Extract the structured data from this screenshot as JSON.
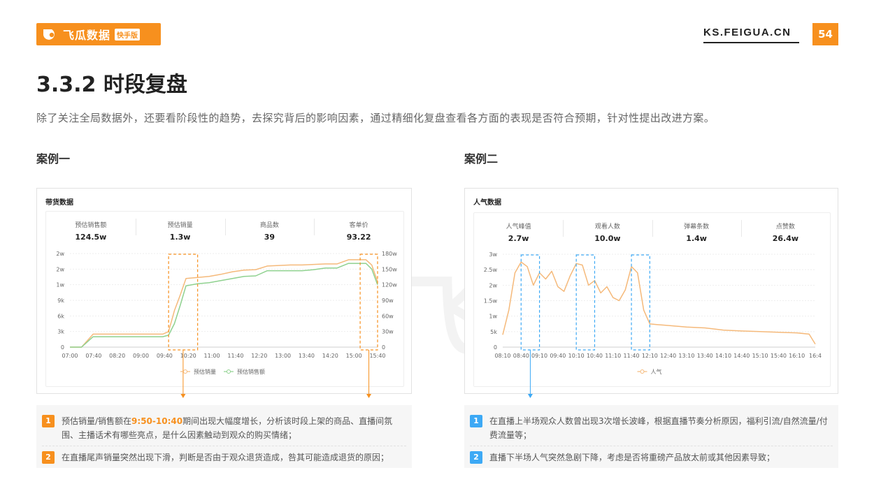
{
  "brand": {
    "name": "飞瓜数据",
    "badge": "快手版",
    "site": "KS.FEIGUA.CN",
    "page": "54",
    "accent": "#f7901e",
    "watermark": "飞瓜数据"
  },
  "title": "3.3.2 时段复盘",
  "subtitle": "除了关注全局数据外，还要看阶段性的趋势，去探究背后的影响因素，通过精细化复盘查看各方面的表现是否符合预期，针对性提出改进方案。",
  "case1": {
    "label": "案例一",
    "panel_title": "带货数据",
    "stats": [
      {
        "label": "预估销售额",
        "value": "124.5w"
      },
      {
        "label": "预估销量",
        "value": "1.3w"
      },
      {
        "label": "商品数",
        "value": "39"
      },
      {
        "label": "客单价",
        "value": "93.22"
      }
    ],
    "notes": [
      {
        "num": "1",
        "pre": "预估销量/销售额在",
        "highlight": "9:50-10:40",
        "post": "期间出现大幅度增长，分析该时段上架的商品、直播间氛围、主播话术有哪些亮点，是什么因素触动到观众的购买情绪；"
      },
      {
        "num": "2",
        "text": "在直播尾声销量突然出现下滑，判断是否由于观众退货造成，咎其可能造成退货的原因；"
      }
    ]
  },
  "case2": {
    "label": "案例二",
    "panel_title": "人气数据",
    "stats": [
      {
        "label": "人气峰值",
        "value": "2.7w"
      },
      {
        "label": "观看人数",
        "value": "10.0w"
      },
      {
        "label": "弹幕条数",
        "value": "1.4w"
      },
      {
        "label": "点赞数",
        "value": "26.4w"
      }
    ],
    "notes": [
      {
        "num": "1",
        "text": "在直播上半场观众人数曾出现3次增长波峰，根据直播节奏分析原因，福利引流/自然流量/付费流量等；"
      },
      {
        "num": "2",
        "text": "直播下半场人气突然急剧下降，考虑是否将重磅产品放太前或其他因素导致；"
      }
    ]
  },
  "chart_data": [
    {
      "type": "line",
      "x": [
        "07:00",
        "07:20",
        "07:40",
        "08:00",
        "08:20",
        "08:40",
        "09:00",
        "09:20",
        "09:40",
        "09:50",
        "10:00",
        "10:10",
        "10:20",
        "10:30",
        "10:40",
        "11:00",
        "11:20",
        "11:40",
        "12:00",
        "12:20",
        "12:40",
        "13:00",
        "13:20",
        "13:40",
        "14:00",
        "14:20",
        "14:40",
        "15:00",
        "15:20",
        "15:30",
        "15:40",
        "15:50"
      ],
      "x_tick_labels": [
        "07:00",
        "07:40",
        "08:20",
        "09:00",
        "09:40",
        "10:20",
        "11:00",
        "11:40",
        "12:20",
        "13:00",
        "13:40",
        "14:20",
        "15:00",
        "15:40"
      ],
      "y_left_tick_labels": [
        "0",
        "3k",
        "6k",
        "9k",
        "1w",
        "2w",
        "2w"
      ],
      "y_right_tick_labels": [
        "0",
        "30w",
        "60w",
        "90w",
        "120w",
        "150w",
        "180w"
      ],
      "ylim_left": [
        0,
        18000
      ],
      "ylim_right": [
        0,
        1800000
      ],
      "series": [
        {
          "name": "预估销量",
          "color": "#f5b97a",
          "axis": "left",
          "values": [
            0,
            0,
            2500,
            2500,
            2500,
            2500,
            2500,
            2500,
            2500,
            3000,
            7000,
            10000,
            13200,
            13300,
            13400,
            13600,
            14000,
            14500,
            14800,
            14900,
            15600,
            15700,
            15800,
            15800,
            15900,
            16000,
            16000,
            16800,
            16800,
            16800,
            15800,
            12600
          ]
        },
        {
          "name": "预估销售额",
          "color": "#8fd18f",
          "axis": "left",
          "values": [
            0,
            0,
            2000,
            2000,
            2000,
            2000,
            2000,
            2000,
            2000,
            2300,
            4500,
            8000,
            11800,
            12000,
            12200,
            12400,
            12800,
            13200,
            13600,
            13700,
            14700,
            14700,
            14700,
            14700,
            14900,
            15200,
            15200,
            16100,
            16100,
            16100,
            15000,
            12000
          ]
        }
      ],
      "highlights": [
        [
          "09:50",
          "10:40"
        ],
        [
          "15:20",
          "15:50"
        ]
      ],
      "grid": true,
      "legend": "bottom"
    },
    {
      "type": "line",
      "x": [
        "08:10",
        "08:20",
        "08:30",
        "08:40",
        "08:50",
        "09:00",
        "09:10",
        "09:20",
        "09:30",
        "09:40",
        "09:50",
        "10:00",
        "10:10",
        "10:20",
        "10:30",
        "10:40",
        "10:50",
        "11:00",
        "11:10",
        "11:20",
        "11:30",
        "11:40",
        "11:50",
        "12:00",
        "12:10",
        "12:20",
        "12:40",
        "13:10",
        "13:40",
        "14:10",
        "14:40",
        "15:10",
        "15:40",
        "16:10",
        "16:30",
        "16:40"
      ],
      "x_tick_labels": [
        "08:10",
        "08:40",
        "09:10",
        "09:40",
        "10:10",
        "10:40",
        "11:10",
        "11:40",
        "12:10",
        "12:40",
        "13:10",
        "13:40",
        "14:10",
        "14:40",
        "15:10",
        "15:40",
        "16:10",
        "16:4"
      ],
      "y_tick_labels": [
        "0",
        "5k",
        "1w",
        "1.5w",
        "2w",
        "2.5w",
        "3w"
      ],
      "ylim": [
        0,
        30000
      ],
      "series": [
        {
          "name": "人气",
          "color": "#f5b97a",
          "values": [
            4000,
            12000,
            24000,
            27500,
            26000,
            20000,
            24000,
            22000,
            24500,
            19500,
            18000,
            23000,
            27000,
            26500,
            20000,
            21500,
            17500,
            19500,
            16000,
            15000,
            18500,
            26000,
            24000,
            12000,
            7500,
            7300,
            7000,
            6500,
            6200,
            5500,
            5200,
            5000,
            4800,
            4600,
            4200,
            1000
          ]
        }
      ],
      "highlights": [
        [
          "08:40",
          "09:10"
        ],
        [
          "10:10",
          "10:40"
        ],
        [
          "11:40",
          "12:10"
        ]
      ],
      "grid": true,
      "legend": "bottom"
    }
  ]
}
